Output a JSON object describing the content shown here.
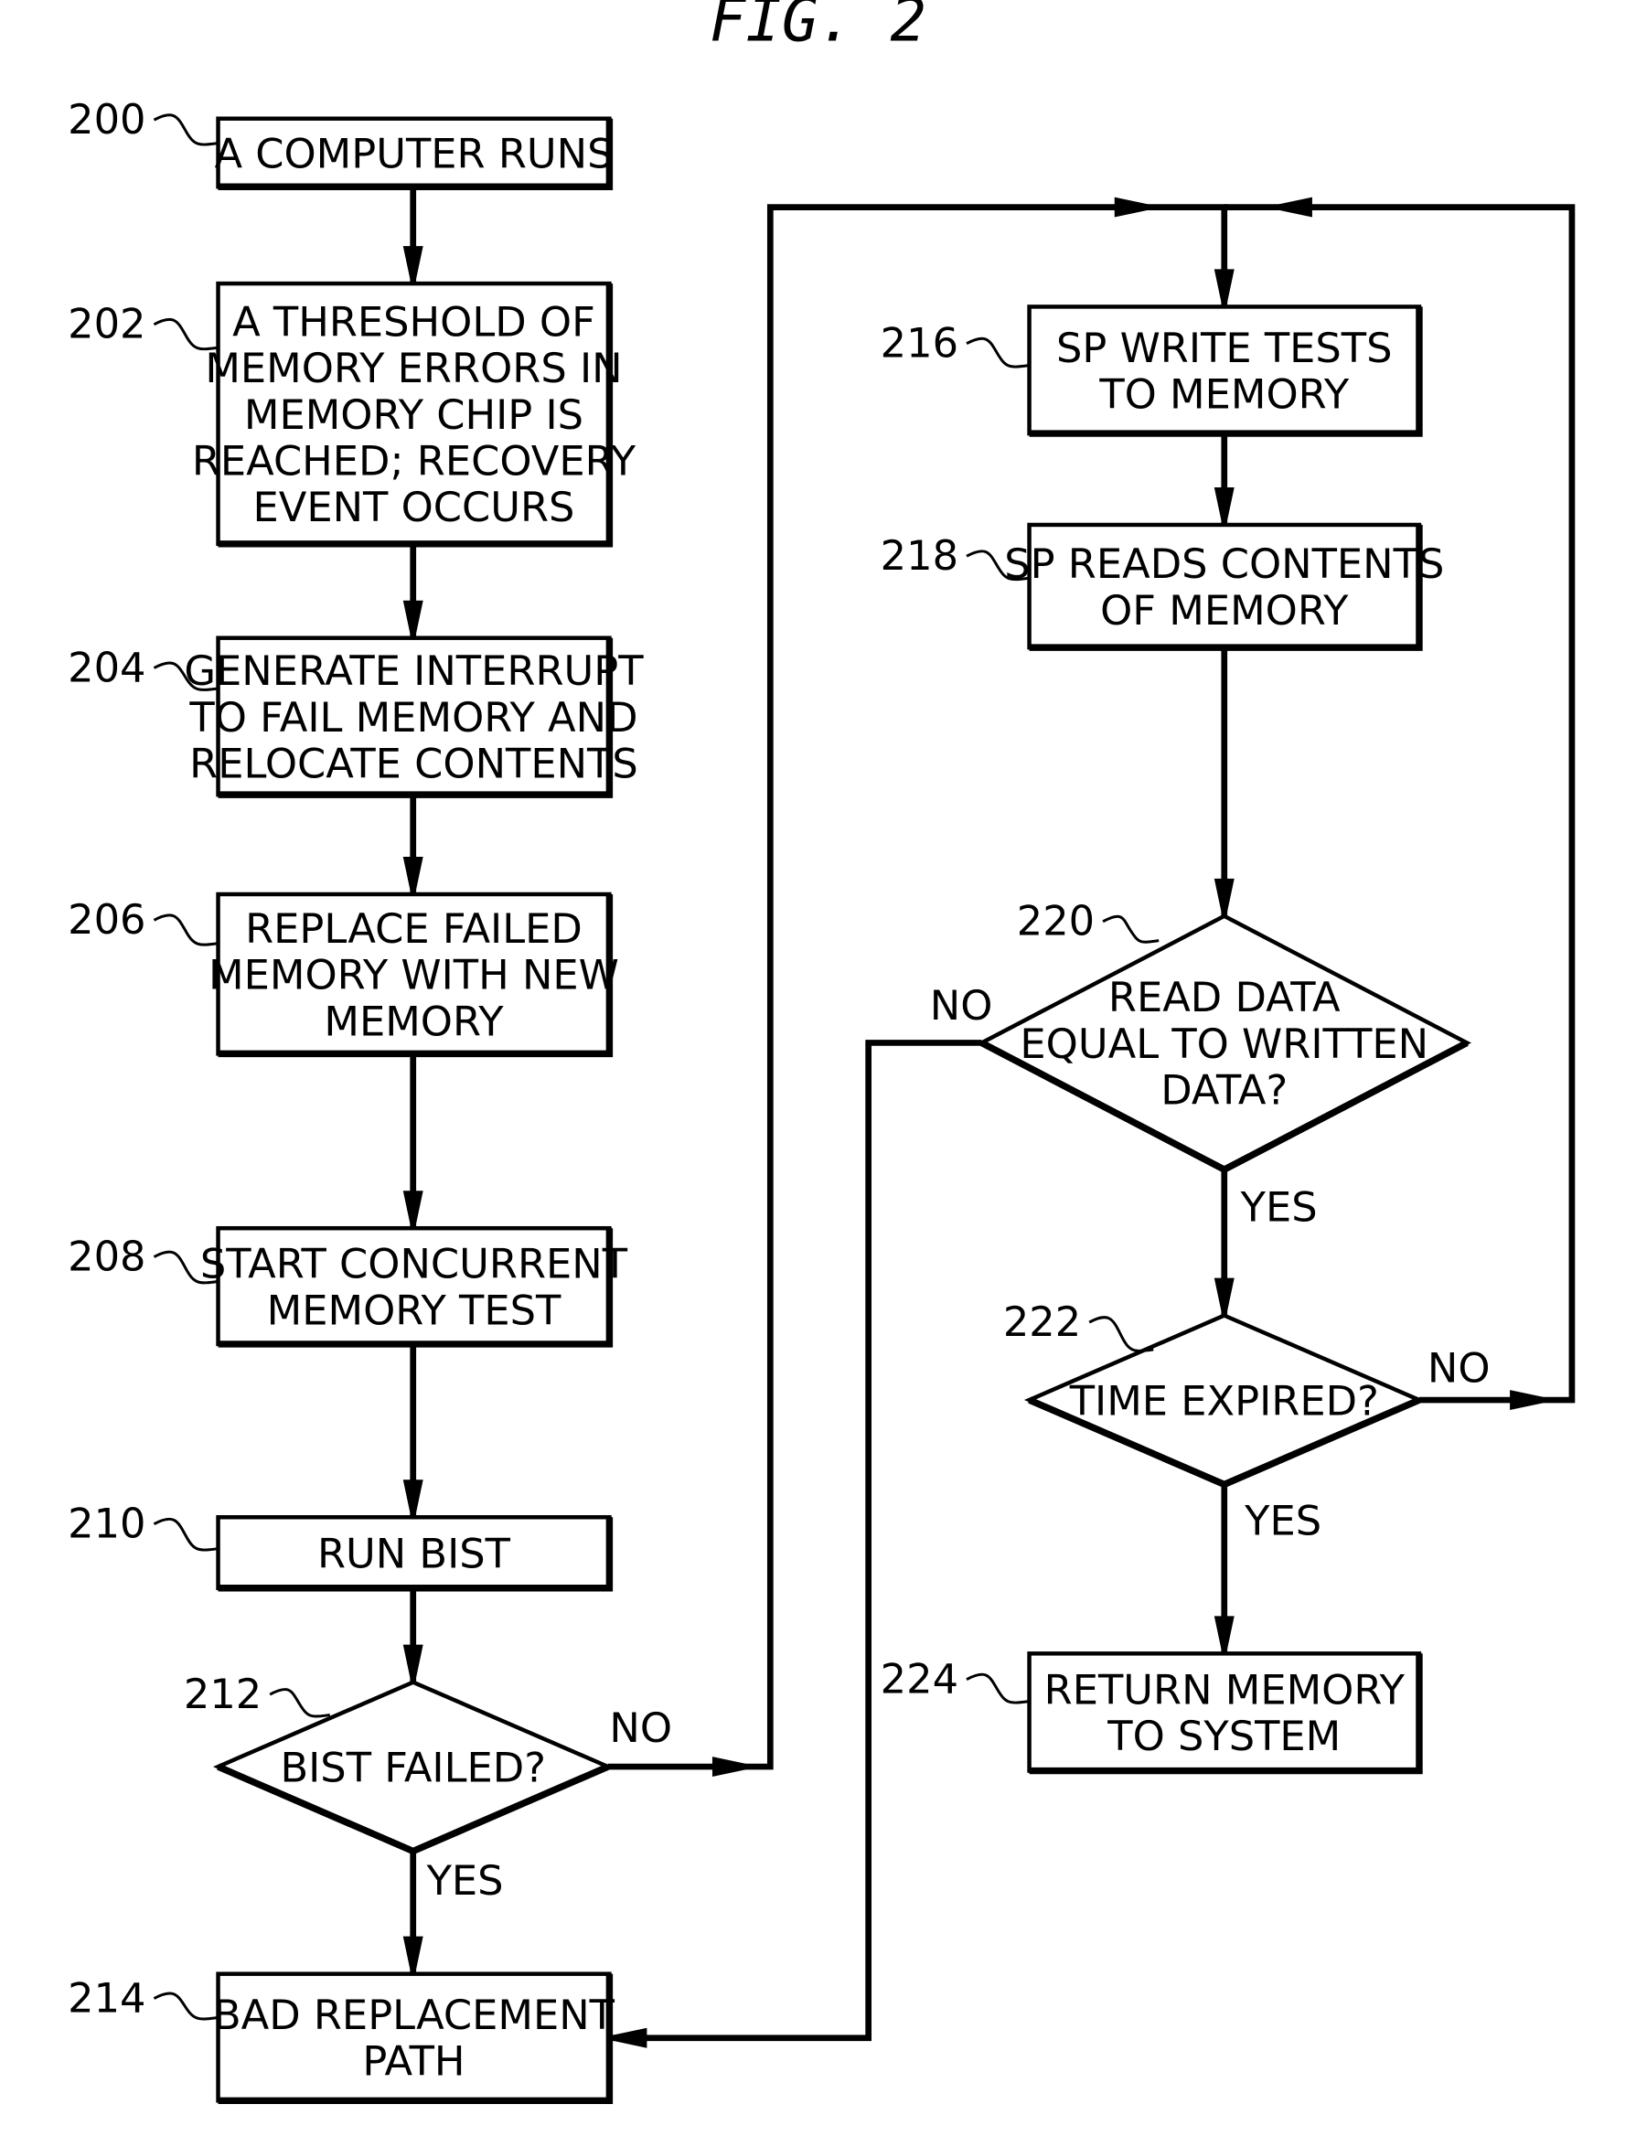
{
  "figure": {
    "title": "FIG. 2"
  },
  "nodes": [
    {
      "id": "200",
      "type": "process",
      "ref": "200",
      "lines": [
        "A COMPUTER RUNS"
      ]
    },
    {
      "id": "202",
      "type": "process",
      "ref": "202",
      "lines": [
        "A THRESHOLD OF",
        "MEMORY ERRORS IN",
        "MEMORY CHIP IS",
        "REACHED; RECOVERY",
        "EVENT OCCURS"
      ]
    },
    {
      "id": "204",
      "type": "process",
      "ref": "204",
      "lines": [
        "GENERATE INTERRUPT",
        "TO FAIL MEMORY AND",
        "RELOCATE CONTENTS"
      ]
    },
    {
      "id": "206",
      "type": "process",
      "ref": "206",
      "lines": [
        "REPLACE FAILED",
        "MEMORY WITH NEW",
        "MEMORY"
      ]
    },
    {
      "id": "208",
      "type": "process",
      "ref": "208",
      "lines": [
        "START CONCURRENT",
        "MEMORY TEST"
      ]
    },
    {
      "id": "210",
      "type": "process",
      "ref": "210",
      "lines": [
        "RUN BIST"
      ]
    },
    {
      "id": "212",
      "type": "decision",
      "ref": "212",
      "lines": [
        "BIST FAILED?"
      ]
    },
    {
      "id": "214",
      "type": "process",
      "ref": "214",
      "lines": [
        "BAD REPLACEMENT",
        "PATH"
      ]
    },
    {
      "id": "216",
      "type": "process",
      "ref": "216",
      "lines": [
        "SP WRITE TESTS",
        "TO MEMORY"
      ]
    },
    {
      "id": "218",
      "type": "process",
      "ref": "218",
      "lines": [
        "SP READS CONTENTS",
        "OF MEMORY"
      ]
    },
    {
      "id": "220",
      "type": "decision",
      "ref": "220",
      "lines": [
        "READ DATA",
        "EQUAL TO WRITTEN",
        "DATA?"
      ]
    },
    {
      "id": "222",
      "type": "decision",
      "ref": "222",
      "lines": [
        "TIME EXPIRED?"
      ]
    },
    {
      "id": "224",
      "type": "process",
      "ref": "224",
      "lines": [
        "RETURN MEMORY",
        "TO SYSTEM"
      ]
    }
  ],
  "edges": [
    {
      "from": "200",
      "to": "202",
      "label": ""
    },
    {
      "from": "202",
      "to": "204",
      "label": ""
    },
    {
      "from": "204",
      "to": "206",
      "label": ""
    },
    {
      "from": "206",
      "to": "208",
      "label": ""
    },
    {
      "from": "208",
      "to": "210",
      "label": ""
    },
    {
      "from": "210",
      "to": "212",
      "label": ""
    },
    {
      "from": "212",
      "to": "214",
      "label": "YES"
    },
    {
      "from": "212",
      "to": "216",
      "label": "NO"
    },
    {
      "from": "216",
      "to": "218",
      "label": ""
    },
    {
      "from": "218",
      "to": "220",
      "label": ""
    },
    {
      "from": "220",
      "to": "222",
      "label": "YES"
    },
    {
      "from": "220",
      "to": "214",
      "label": "NO"
    },
    {
      "from": "222",
      "to": "224",
      "label": "YES"
    },
    {
      "from": "222",
      "to": "216",
      "label": "NO"
    }
  ]
}
